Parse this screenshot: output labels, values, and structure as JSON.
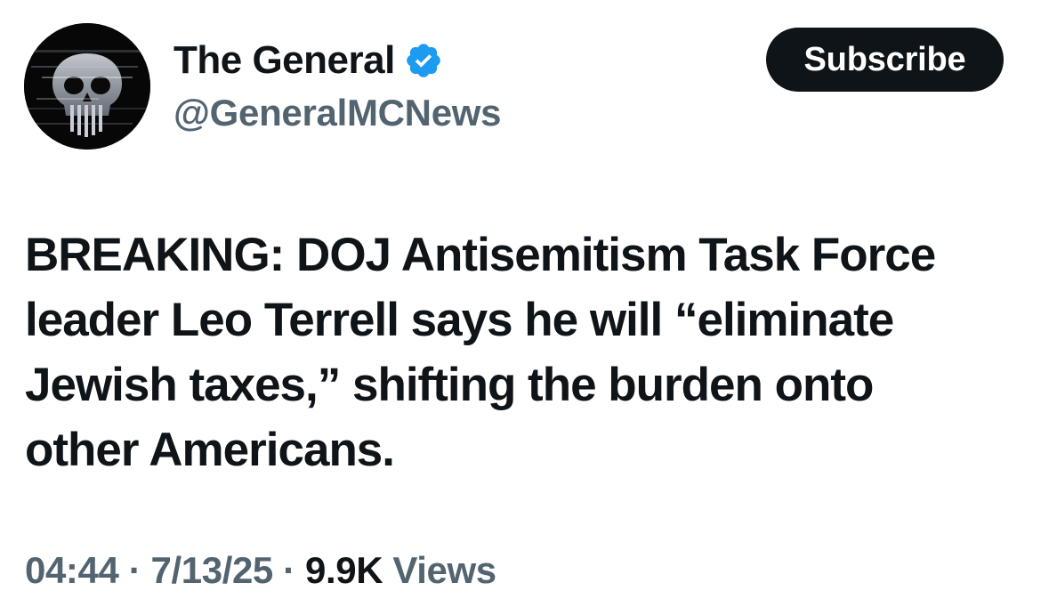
{
  "author": {
    "display_name": "The General",
    "handle": "@GeneralMCNews",
    "verified_icon": "verified-badge-icon",
    "avatar_icon": "skull-avatar"
  },
  "actions": {
    "subscribe_label": "Subscribe"
  },
  "tweet": {
    "lines": [
      "BREAKING: DOJ Antisemitism Task Force",
      "leader Leo Terrell says he will “eliminate",
      "Jewish taxes,” shifting the burden onto",
      "other Americans."
    ]
  },
  "meta": {
    "time": "04:44",
    "separator": " · ",
    "date": "7/13/25",
    "views_count": "9.9K",
    "views_label": " Views"
  },
  "colors": {
    "primary_text": "#0f1419",
    "secondary_text": "#536471",
    "verified_blue": "#1d9bf0",
    "button_bg": "#0f1419"
  }
}
